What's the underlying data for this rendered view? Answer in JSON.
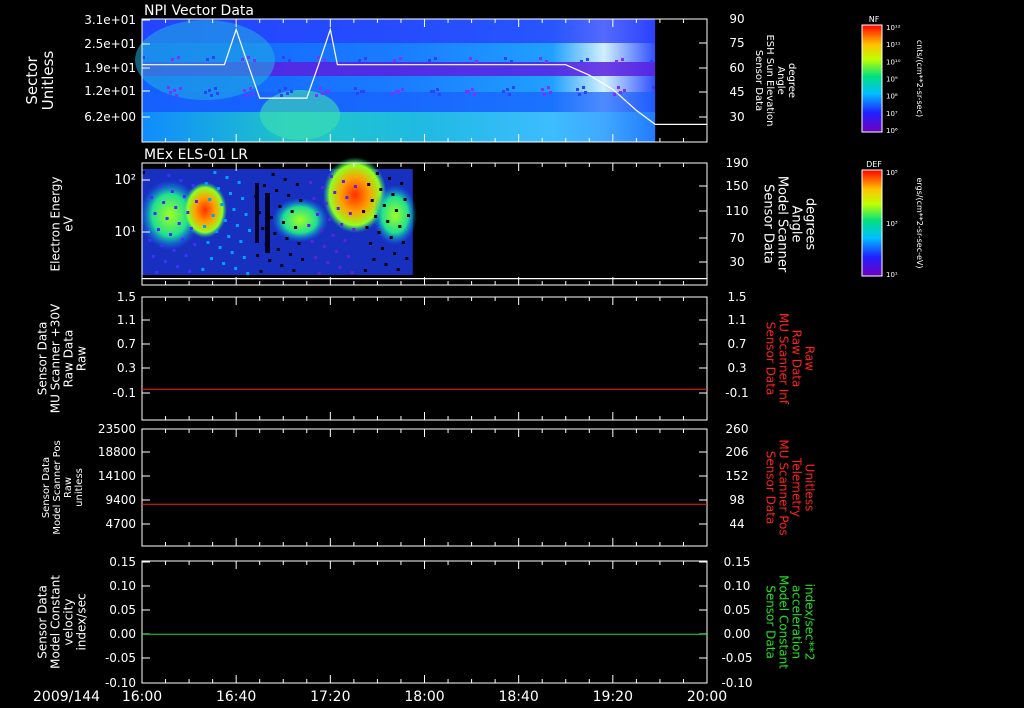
{
  "chart_data": [
    {
      "type": "heatmap",
      "title": "NPI Vector Data",
      "ylabel": [
        "Sector",
        "Unitless"
      ],
      "yticks": [
        "3.1e+01",
        "2.5e+01",
        "1.9e+01",
        "1.2e+01",
        "6.2e+00"
      ],
      "y2label": [
        "Sensor Data",
        "ESH Sun Elevation",
        "Angle",
        "degree"
      ],
      "y2ticks": [
        "90",
        "75",
        "60",
        "45",
        "30"
      ],
      "y2lim": [
        20,
        90
      ],
      "overlay": {
        "name": "ESH Sun Elevation Angle",
        "color": "#ffffff",
        "x": [
          "16:00",
          "16:25",
          "16:35",
          "16:40",
          "16:43",
          "16:50",
          "16:55",
          "17:00",
          "17:10",
          "17:15",
          "17:20",
          "17:23",
          "17:30",
          "18:00",
          "19:00",
          "19:10",
          "19:20",
          "19:30",
          "19:38",
          "20:00"
        ],
        "y": [
          64,
          64,
          64,
          84,
          72,
          45,
          45,
          45,
          45,
          64,
          84,
          64,
          64,
          64,
          64,
          58,
          50,
          38,
          30,
          30
        ]
      },
      "data_end": "19:38",
      "colorbar": {
        "label": "NF",
        "unit": "cnts/(cm**2-sr-sec)",
        "ticks": [
          "10¹²",
          "10¹¹",
          "10¹⁰",
          "10⁹",
          "10⁸",
          "10⁷",
          "10⁶"
        ]
      }
    },
    {
      "type": "heatmap",
      "title": "MEx ELS-01 LR",
      "ylabel": [
        "Electron Energy",
        "eV"
      ],
      "yticks": [
        "10²",
        "10¹"
      ],
      "y2label": [
        "Sensor Data",
        "Model Scanner",
        "Angle",
        "degrees"
      ],
      "y2ticks": [
        "190",
        "150",
        "110",
        "70",
        "30"
      ],
      "y2lim": [
        0,
        190
      ],
      "overlay": {
        "name": "Model Scanner Angle",
        "color": "#ffffff",
        "x": [
          "16:00",
          "20:00"
        ],
        "y": [
          10,
          10
        ]
      },
      "data_end": "17:55",
      "colorbar": {
        "label": "DEF",
        "unit": "ergs/(cm**2-sr-sec-eV)",
        "ticks": [
          "10⁵",
          "10³",
          "10¹"
        ]
      }
    },
    {
      "type": "line",
      "ylabel": [
        "Sensor Data",
        "MU Scanner +30V",
        "Raw Data",
        "Raw"
      ],
      "yticks": [
        "1.5",
        "1.1",
        "0.7",
        "0.3",
        "-0.1"
      ],
      "ylim": [
        -0.5,
        1.5
      ],
      "y2label": [
        "Sensor Data",
        "MU Scanner Inf",
        "Raw Data",
        "Raw"
      ],
      "y2ticks": [
        "1.5",
        "1.1",
        "0.7",
        "0.3",
        "-0.1"
      ],
      "y2color": "#ff2020",
      "series": [
        {
          "color": "#ff2020",
          "x": [
            "16:00",
            "20:00"
          ],
          "y": [
            0,
            0
          ]
        }
      ]
    },
    {
      "type": "line",
      "ylabel": [
        "Sensor Data",
        "Model Scanner Pos",
        "Raw",
        "unitless"
      ],
      "yticks": [
        "23500",
        "18800",
        "14100",
        "9400",
        "4700"
      ],
      "ylim": [
        0,
        23500
      ],
      "y2label": [
        "Sensor Data",
        "MU Scanner Pos",
        "Telemetry",
        "Unitless"
      ],
      "y2ticks": [
        "260",
        "206",
        "152",
        "98",
        "44"
      ],
      "y2color": "#ff2020",
      "series": [
        {
          "color": "#ff2020",
          "x": [
            "16:00",
            "20:00"
          ],
          "y": [
            8400,
            8400
          ]
        }
      ]
    },
    {
      "type": "line",
      "ylabel": [
        "Sensor Data",
        "Model Constant",
        "velocity",
        "index/sec"
      ],
      "yticks": [
        "0.15",
        "0.10",
        "0.05",
        "0.00",
        "-0.05",
        "-0.10"
      ],
      "ylim": [
        -0.1,
        0.15
      ],
      "y2label": [
        "Sensor Data",
        "Model Constant",
        "acceleration",
        "index/sec**2"
      ],
      "y2ticks": [
        "0.15",
        "0.10",
        "0.05",
        "0.00",
        "-0.05",
        "-0.10"
      ],
      "y2color": "#20e020",
      "series": [
        {
          "color": "#20e020",
          "x": [
            "16:00",
            "20:00"
          ],
          "y": [
            0,
            0
          ]
        }
      ]
    }
  ],
  "x_axis": {
    "date": "2009/144",
    "ticks": [
      "16:00",
      "16:40",
      "17:20",
      "18:00",
      "18:40",
      "19:20",
      "20:00"
    ],
    "xlim": [
      "16:00",
      "20:00"
    ]
  }
}
